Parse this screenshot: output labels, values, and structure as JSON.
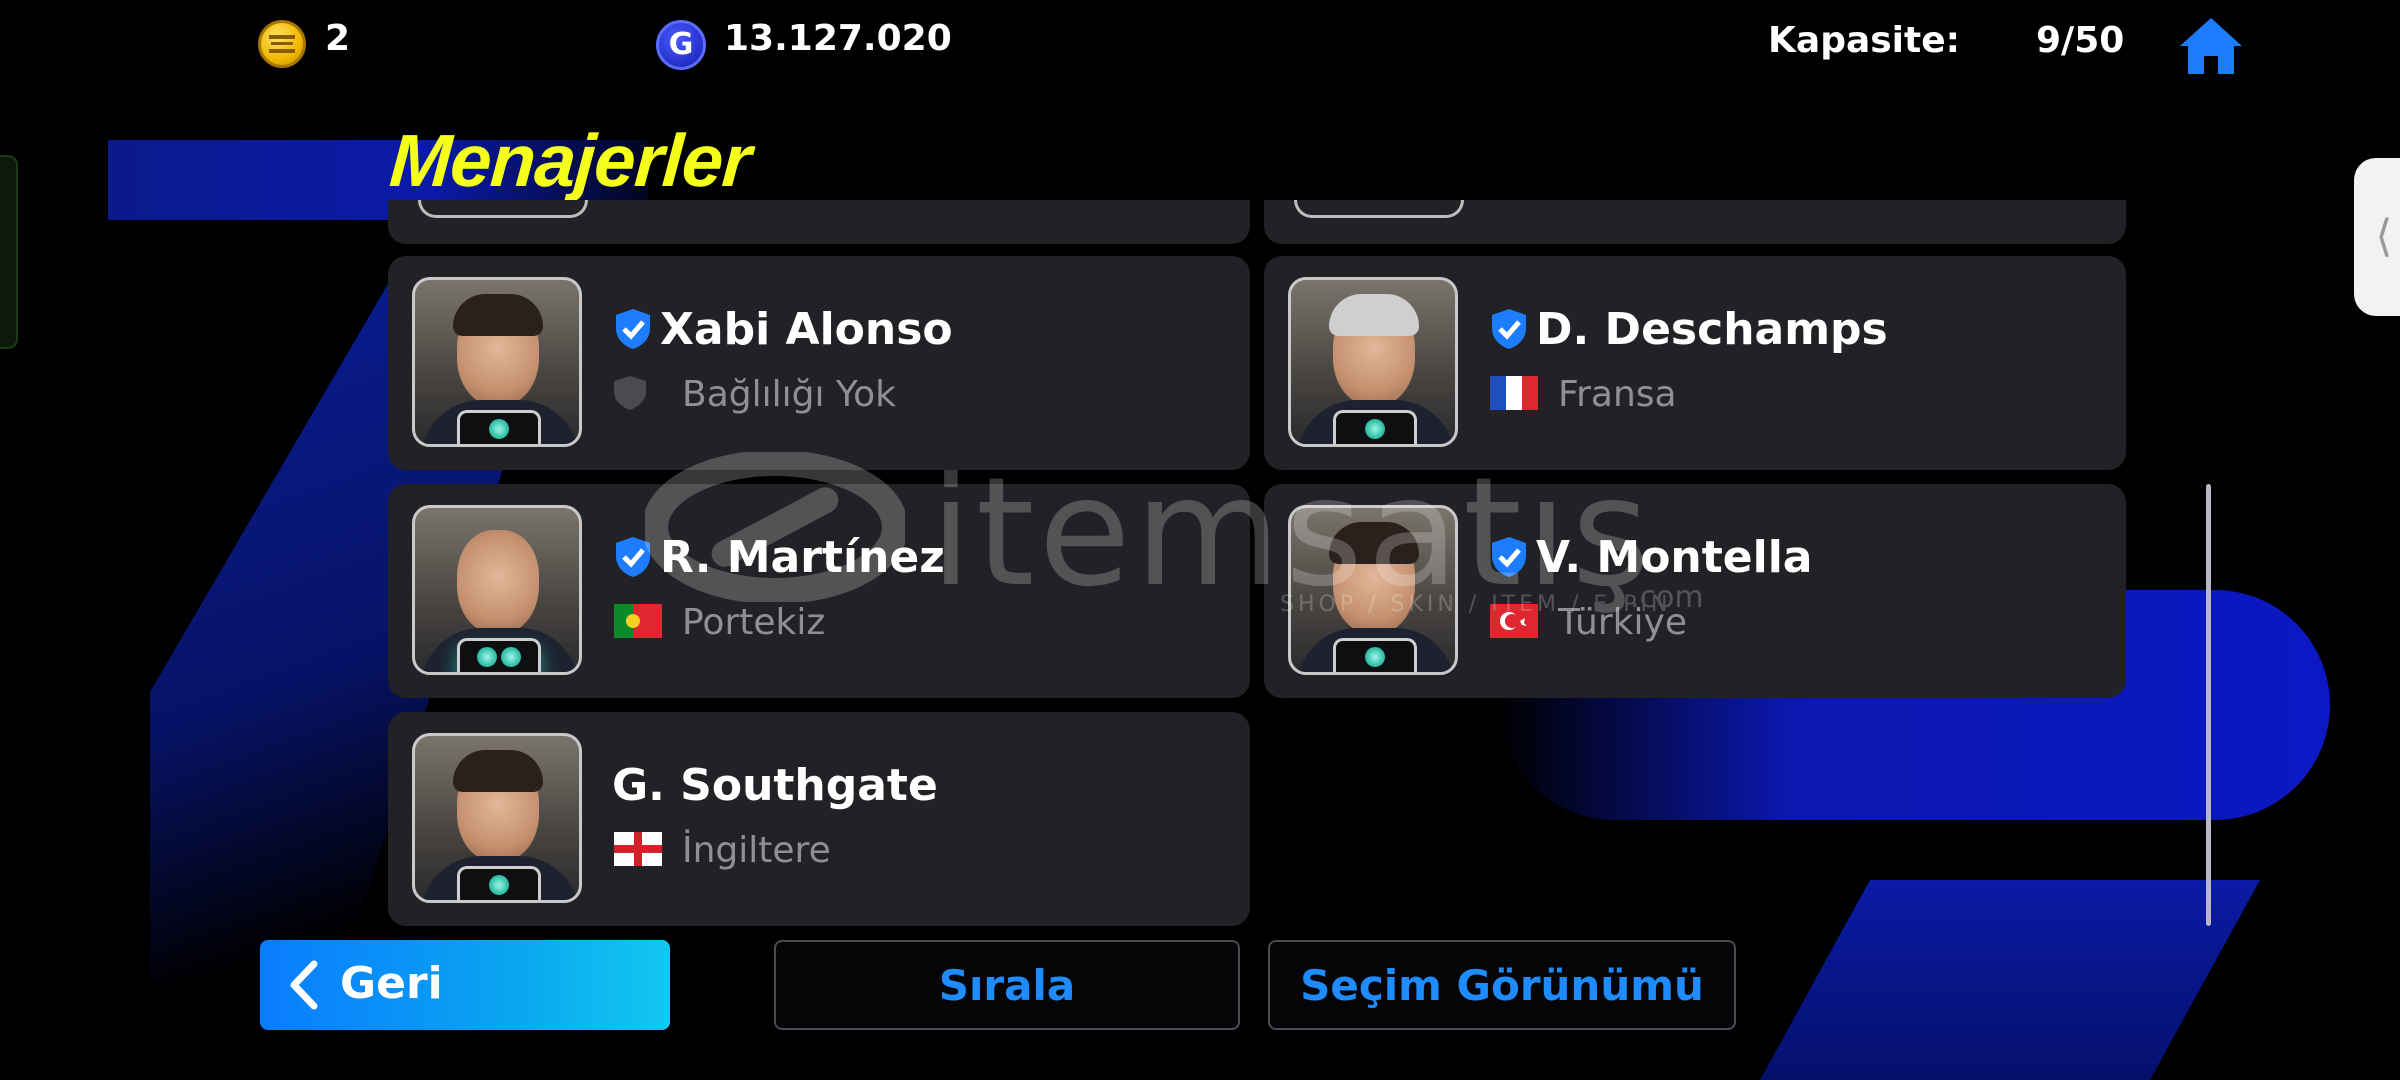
{
  "topbar": {
    "coins": "2",
    "gp": "13.127.020",
    "gp_icon_letter": "G",
    "capacity_label": "Kapasite:",
    "capacity_value": "9/50"
  },
  "page_title": "Menajerler",
  "managers": [
    {
      "name": "Xabi Alonso",
      "verified": true,
      "affiliation": "Bağlılığı Yok",
      "affiliation_icon": "shield-icon",
      "badge_count": 1
    },
    {
      "name": "D. Deschamps",
      "verified": true,
      "affiliation": "Fransa",
      "affiliation_icon": "france-flag-icon",
      "badge_count": 1
    },
    {
      "name": "R. Martínez",
      "verified": true,
      "affiliation": "Portekiz",
      "affiliation_icon": "portugal-flag-icon",
      "badge_count": 2
    },
    {
      "name": "V. Montella",
      "verified": true,
      "affiliation": "Türkiye",
      "affiliation_icon": "turkey-flag-icon",
      "badge_count": 1
    },
    {
      "name": "G. Southgate",
      "verified": false,
      "affiliation": "İngiltere",
      "affiliation_icon": "england-flag-icon",
      "badge_count": 1
    }
  ],
  "watermark": {
    "text": "itemsatış",
    "sub": "SHOP / SKIN / ITEM / E-PIN",
    "com": ".com"
  },
  "buttons": {
    "back": "Geri",
    "sort": "Sırala",
    "selection_view": "Seçim Görünümü"
  },
  "side_tab": "⟨",
  "colors": {
    "title": "#f4ff1a",
    "accent_blue": "#1e8cff",
    "card_bg": "#222226"
  }
}
